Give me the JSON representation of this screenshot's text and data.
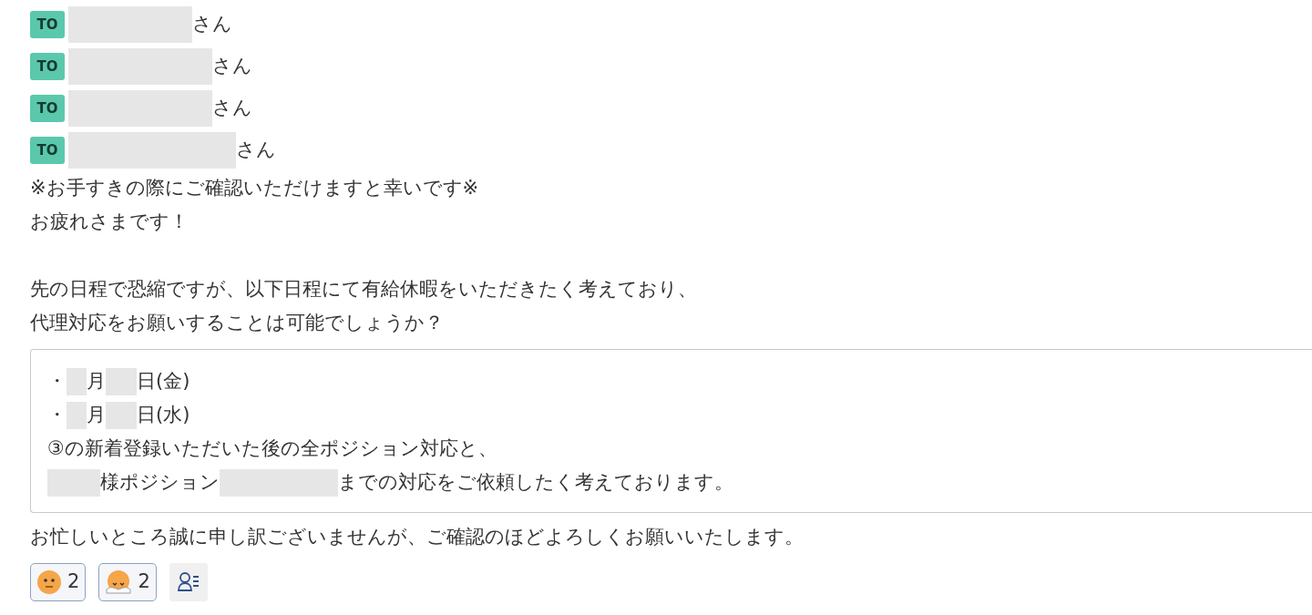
{
  "mentions": [
    {
      "badge": "TO",
      "suffix": "さん"
    },
    {
      "badge": "TO",
      "suffix": "さん"
    },
    {
      "badge": "TO",
      "suffix": "さん"
    },
    {
      "badge": "TO",
      "suffix": "さん"
    }
  ],
  "paragraphs": [
    [
      "※お手すきの際にご確認いただけますと幸いです※",
      "お疲れさまです！"
    ],
    [
      "先の日程で恐縮ですが、以下日程にて有給休暇をいただきたく考えており、",
      "代理対応をお願いすることは可能でしょうか？"
    ]
  ],
  "quote_lines": [
    {
      "segments": [
        {
          "kind": "text",
          "text": "・"
        },
        {
          "kind": "redacted"
        },
        {
          "kind": "text",
          "text": "月"
        },
        {
          "kind": "redacted"
        },
        {
          "kind": "text",
          "text": "日(金)"
        }
      ]
    },
    {
      "segments": [
        {
          "kind": "text",
          "text": "・"
        },
        {
          "kind": "redacted"
        },
        {
          "kind": "text",
          "text": "月"
        },
        {
          "kind": "redacted"
        },
        {
          "kind": "text",
          "text": "日(水)"
        }
      ]
    },
    {
      "segments": [
        {
          "kind": "text",
          "text": "③の新着登録いただいた後の全ポジション対応と、"
        }
      ]
    },
    {
      "segments": [
        {
          "kind": "redacted"
        },
        {
          "kind": "text",
          "text": "様ポジション"
        },
        {
          "kind": "redacted"
        },
        {
          "kind": "text",
          "text": "までの対応をご依頼したく考えております。"
        }
      ]
    }
  ],
  "closing": "お忙しいところ誠に申し訳ございませんが、ご確認のほどよろしくお願いいたします。",
  "reactions": [
    {
      "kind": "smile",
      "count": "2"
    },
    {
      "kind": "bow",
      "count": "2"
    }
  ]
}
